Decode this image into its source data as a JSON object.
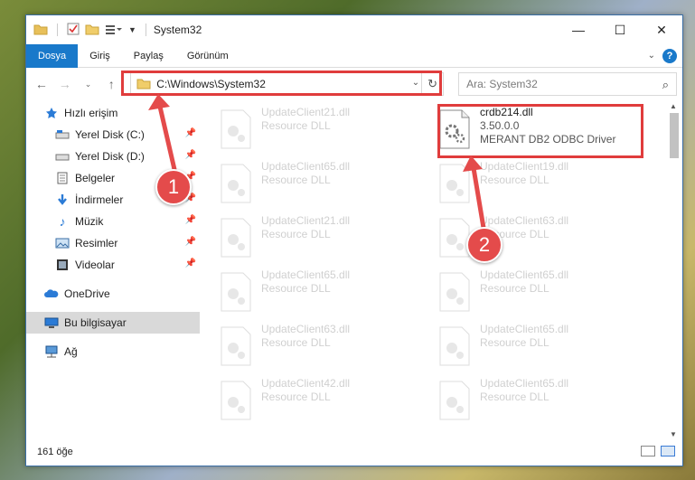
{
  "window": {
    "title": "System32"
  },
  "ribbon": {
    "tabs": [
      "Dosya",
      "Giriş",
      "Paylaş",
      "Görünüm"
    ],
    "help_label": "?"
  },
  "address": {
    "path": "C:\\Windows\\System32"
  },
  "search": {
    "placeholder": "Ara: System32"
  },
  "sidebar": {
    "items": [
      {
        "label": "Hızlı erişim",
        "icon": "star-icon",
        "pinned": false
      },
      {
        "label": "Yerel Disk (C:)",
        "icon": "drive-icon",
        "pinned": true
      },
      {
        "label": "Yerel Disk (D:)",
        "icon": "drive-icon",
        "pinned": true
      },
      {
        "label": "Belgeler",
        "icon": "documents-icon",
        "pinned": true
      },
      {
        "label": "İndirmeler",
        "icon": "download-icon",
        "pinned": true
      },
      {
        "label": "Müzik",
        "icon": "music-icon",
        "pinned": true
      },
      {
        "label": "Resimler",
        "icon": "pictures-icon",
        "pinned": true
      },
      {
        "label": "Videolar",
        "icon": "video-icon",
        "pinned": true
      },
      {
        "label": "OneDrive",
        "icon": "cloud-icon",
        "pinned": false
      },
      {
        "label": "Bu bilgisayar",
        "icon": "computer-icon",
        "pinned": false
      },
      {
        "label": "Ağ",
        "icon": "network-icon",
        "pinned": false
      }
    ]
  },
  "files": {
    "highlight": {
      "name": "crdb214.dll",
      "version": "3.50.0.0",
      "description": "MERANT DB2 ODBC Driver"
    },
    "left_column": [
      {
        "name": "UpdateClient21.dll",
        "type": "Resource DLL"
      },
      {
        "name": "UpdateClient65.dll",
        "type": "Resource DLL"
      },
      {
        "name": "UpdateClient21.dll",
        "type": "Resource DLL"
      },
      {
        "name": "UpdateClient65.dll",
        "type": "Resource DLL"
      },
      {
        "name": "UpdateClient63.dll",
        "type": "Resource DLL"
      },
      {
        "name": "UpdateClient42.dll",
        "type": "Resource DLL"
      }
    ],
    "right_column": [
      {
        "name": "UpdateClient19.dll",
        "type": "Resource DLL"
      },
      {
        "name": "UpdateClient63.dll",
        "type": "Resource DLL"
      },
      {
        "name": "UpdateClient65.dll",
        "type": "Resource DLL"
      },
      {
        "name": "UpdateClient65.dll",
        "type": "Resource DLL"
      },
      {
        "name": "UpdateClient65.dll",
        "type": "Resource DLL"
      }
    ]
  },
  "status": {
    "count": "161 öğe"
  },
  "callouts": [
    "1",
    "2"
  ],
  "colors": {
    "accent": "#1979ca",
    "annotation": "#e44b4b"
  }
}
